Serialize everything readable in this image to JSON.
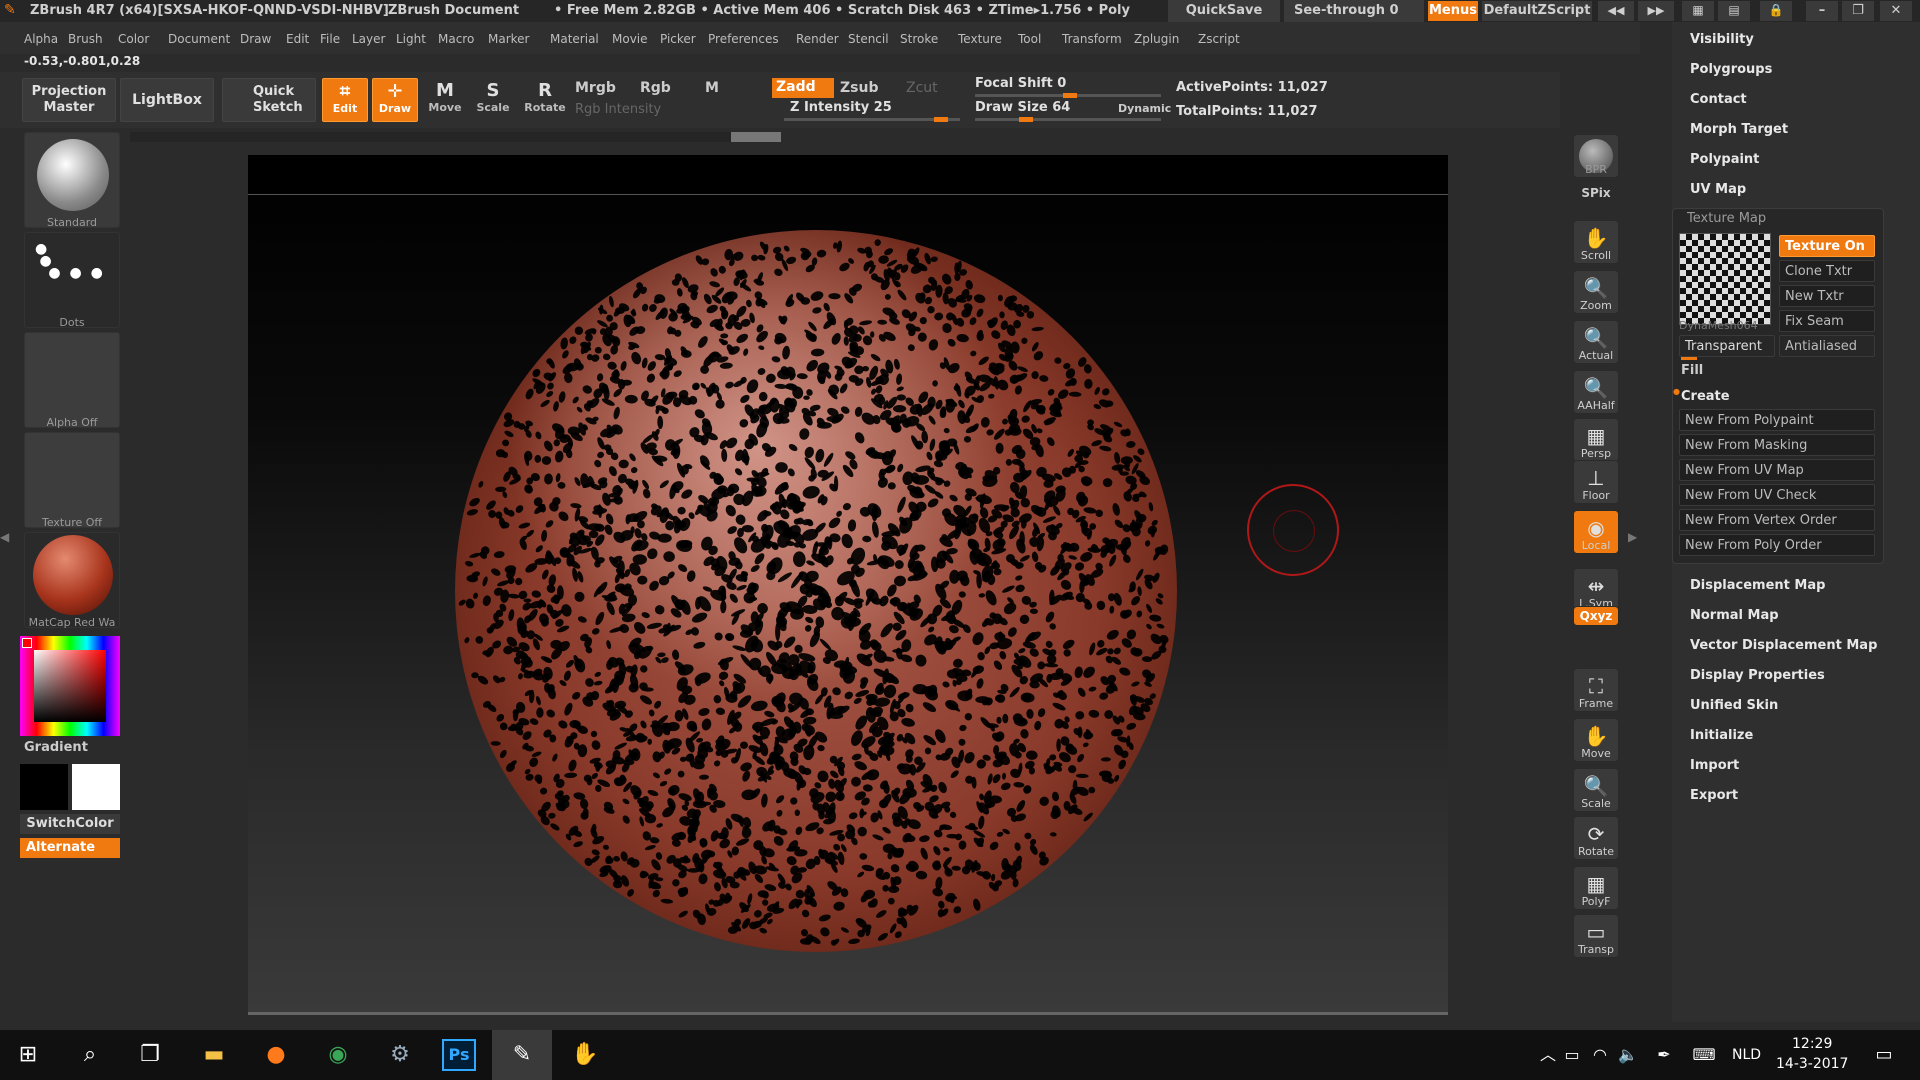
{
  "titlebar": {
    "app": "ZBrush 4R7 (x64)[SXSA-HKOF-QNND-VSDI-NHBV]",
    "doc": "ZBrush Document",
    "stats": "• Free Mem 2.82GB • Active Mem 406 • Scratch Disk 463 • ZTime▸1.756 • Poly",
    "quicksave": "QuickSave",
    "seethrough": "See-through  0",
    "menus": "Menus",
    "script": "DefaultZScript"
  },
  "menubar": [
    "Alpha",
    "Brush",
    "Color",
    "Document",
    "Draw",
    "Edit",
    "File",
    "Layer",
    "Light",
    "Macro",
    "Marker",
    "Material",
    "Movie",
    "Picker",
    "Preferences",
    "Render",
    "Stencil",
    "Stroke",
    "Texture",
    "Tool",
    "Transform",
    "Zplugin",
    "Zscript"
  ],
  "coords": "-0.53,-0.801,0.28",
  "toolbar": {
    "projection_master": "Projection Master",
    "lightbox": "LightBox",
    "quick_sketch": "Quick Sketch",
    "edit": "Edit",
    "draw": "Draw",
    "move": "Move",
    "scale": "Scale",
    "rotate": "Rotate",
    "mrgb": "Mrgb",
    "rgb": "Rgb",
    "m": "M",
    "rgb_intensity": "Rgb Intensity",
    "zadd": "Zadd",
    "zsub": "Zsub",
    "zcut": "Zcut",
    "z_intensity": "Z Intensity 25",
    "z_intensity_value": 25,
    "focal_shift": "Focal Shift 0",
    "draw_size": "Draw Size 64",
    "dynamic": "Dynamic",
    "active_points": "ActivePoints: 11,027",
    "total_points": "TotalPoints: 11,027"
  },
  "left": {
    "standard": "Standard",
    "dots": "Dots",
    "alpha_off": "Alpha  Off",
    "texture_off": "Texture  Off",
    "matcap": "MatCap  Red  Wa",
    "gradient": "Gradient",
    "switchcolor": "SwitchColor",
    "alternate": "Alternate"
  },
  "rightbar": [
    {
      "label": "BPR",
      "icon": "bpr-icon"
    },
    {
      "label": "SPix",
      "icon": "spix-icon"
    },
    {
      "label": "Scroll",
      "icon": "scroll-icon",
      "glyph": "✋"
    },
    {
      "label": "Zoom",
      "icon": "zoom-icon",
      "glyph": "🔍"
    },
    {
      "label": "Actual",
      "icon": "actual-icon",
      "glyph": "🔍"
    },
    {
      "label": "AAHalf",
      "icon": "aahalf-icon",
      "glyph": "🔍"
    },
    {
      "label": "Persp",
      "icon": "persp-icon",
      "glyph": "▦"
    },
    {
      "label": "Floor",
      "icon": "floor-icon",
      "glyph": "⊥"
    },
    {
      "label": "Local",
      "icon": "local-icon",
      "glyph": "◉"
    },
    {
      "label": "L.Sym",
      "icon": "lsym-icon",
      "glyph": "⇹"
    },
    {
      "label": "Qxyz",
      "icon": "xyz-icon"
    },
    {
      "label": "Frame",
      "icon": "frame-icon",
      "glyph": "⛶"
    },
    {
      "label": "Move",
      "icon": "move-icon",
      "glyph": "✋"
    },
    {
      "label": "Scale",
      "icon": "scale-icon",
      "glyph": "🔍"
    },
    {
      "label": "Rotate",
      "icon": "rotate-icon",
      "glyph": "⟳"
    },
    {
      "label": "PolyF",
      "icon": "polyf-icon",
      "glyph": "▦"
    },
    {
      "label": "Transp",
      "icon": "transp-icon",
      "glyph": "▭"
    }
  ],
  "rightpanel": {
    "top_items": [
      "Visibility",
      "Polygroups",
      "Contact",
      "Morph Target",
      "Polypaint",
      "UV Map"
    ],
    "texture_map": {
      "title": "Texture Map",
      "thumb_label": "DynaMesh064",
      "texture_on": "Texture On",
      "clone_txtr": "Clone Txtr",
      "new_txtr": "New Txtr",
      "fix_seam": "Fix Seam",
      "transparent": "Transparent",
      "antialiased": "Antialiased",
      "fill": "Fill",
      "create": "Create",
      "create_items": [
        "New From Polypaint",
        "New From Masking",
        "New From UV Map",
        "New From UV Check",
        "New From Vertex Order",
        "New From Poly Order"
      ]
    },
    "bottom_items": [
      "Displacement Map",
      "Normal Map",
      "Vector Displacement Map",
      "Display Properties",
      "Unified Skin",
      "Initialize",
      "Import",
      "Export"
    ]
  },
  "taskbar": {
    "lang": "NLD",
    "time": "12:29",
    "date": "14-3-2017"
  }
}
